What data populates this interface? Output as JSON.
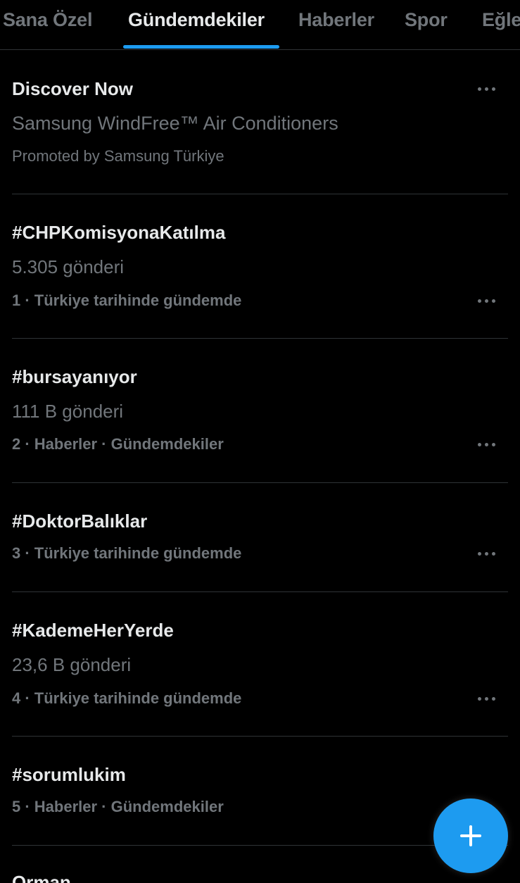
{
  "tabs": [
    {
      "label": "Sana Özel",
      "active": false
    },
    {
      "label": "Gündemdekiler",
      "active": true
    },
    {
      "label": "Haberler",
      "active": false
    },
    {
      "label": "Spor",
      "active": false
    },
    {
      "label": "Eğlence",
      "active": false
    }
  ],
  "promoted": {
    "title": "Discover Now",
    "subtitle": "Samsung WindFree™ Air Conditioners",
    "promoted_by": "Promoted by Samsung Türkiye"
  },
  "trends": [
    {
      "name": "#CHPKomisyonaKatılma",
      "posts": "5.305 gönderi",
      "context": "1 · Türkiye tarihinde gündemde"
    },
    {
      "name": "#bursayanıyor",
      "posts": "111 B gönderi",
      "context": "2 · Haberler · Gündemdekiler"
    },
    {
      "name": "#DoktorBalıklar",
      "posts": "",
      "context": "3 · Türkiye tarihinde gündemde"
    },
    {
      "name": "#KademeHerYerde",
      "posts": "23,6 B gönderi",
      "context": "4 · Türkiye tarihinde gündemde"
    },
    {
      "name": "#sorumlukim",
      "posts": "",
      "context": "5 · Haberler · Gündemdekiler"
    },
    {
      "name": "Orman",
      "posts": "",
      "context": ""
    }
  ],
  "icons": {
    "more": "more-horizontal-icon",
    "compose": "plus-icon"
  },
  "colors": {
    "background": "#000000",
    "accent": "#1d9bf0",
    "text_primary": "#e7e9ea",
    "text_secondary": "#71767b",
    "divider": "#2f3336"
  }
}
